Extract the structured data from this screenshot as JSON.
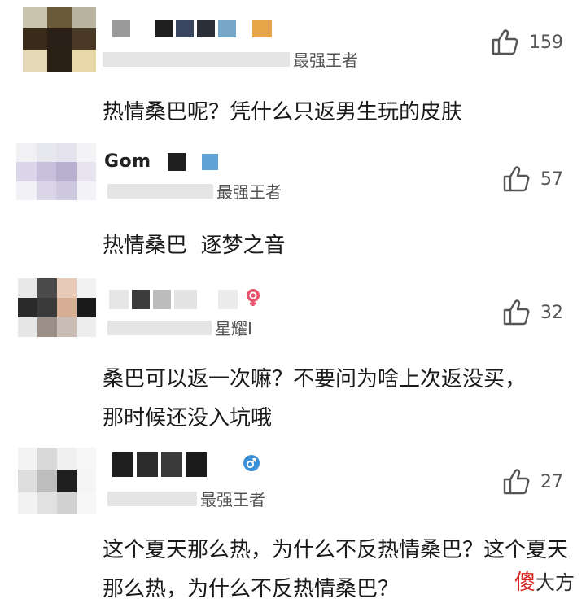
{
  "comments": [
    {
      "name": "",
      "rank": "最强王者",
      "likes": "159",
      "text": "热情桑巴呢？凭什么只返男生玩的皮肤"
    },
    {
      "name": "Gom",
      "rank": "最强王者",
      "likes": "57",
      "text": "热情桑巴  逐梦之音"
    },
    {
      "name": "",
      "rank": "星耀Ⅰ",
      "likes": "32",
      "gender_icon": "female-icon",
      "text": "桑巴可以返一次嘛？不要问为啥上次返没买，那时候还没入坑哦"
    },
    {
      "name": "",
      "rank": "最强王者",
      "likes": "27",
      "gender_icon": "male-icon",
      "text": "这个夏天那么热，为什么不反热情桑巴？这个夏天那么热，为什么不反热情桑巴？"
    }
  ],
  "watermark": {
    "part1": "傻",
    "part2": "大方"
  },
  "colors": {
    "female": "#e8526f",
    "male": "#3b8fd6",
    "text": "#1a1a1a",
    "meta": "#555555"
  }
}
